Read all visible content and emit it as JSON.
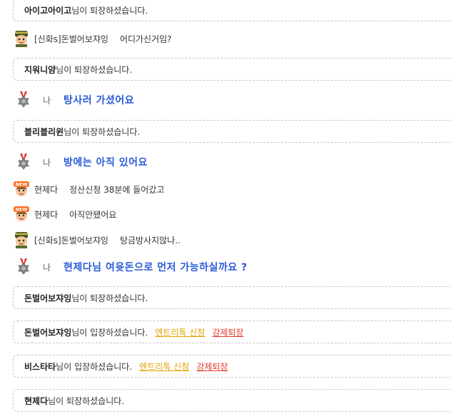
{
  "messages": [
    {
      "type": "system",
      "name": "아이고아이고",
      "suffix": "님이 퇴장하셨습니다."
    },
    {
      "type": "user",
      "nick": "[신화s]돈벌어보쟈잉",
      "text": "어디가신거임?",
      "avatar": "soldier-avatar-icon"
    },
    {
      "type": "system",
      "name": "지워니얌",
      "suffix": "님이 퇴장하셨습니다."
    },
    {
      "type": "mine",
      "me": "나",
      "text": "탕사러 가셨어요",
      "icon": "medal-icon"
    },
    {
      "type": "system",
      "name": "블리블리윈",
      "suffix": "님이 퇴장하셨습니다."
    },
    {
      "type": "mine",
      "me": "나",
      "text": "방에는 아직 있어요",
      "icon": "medal-icon"
    },
    {
      "type": "user",
      "nick": "현제다",
      "text": "정산신청 38분에 들어갔고",
      "avatar": "new-badge-avatar-icon"
    },
    {
      "type": "user",
      "nick": "현제다",
      "text": "아직안됐어요",
      "avatar": "new-badge-avatar-icon"
    },
    {
      "type": "user",
      "nick": "[신화s]돈벌어보쟈잉",
      "text": "탕금방사지않나..",
      "avatar": "soldier-avatar-icon"
    },
    {
      "type": "mine",
      "me": "나",
      "text": "현제다님 여윳돈으로 먼저 가능하실까요 ?",
      "icon": "medal-icon"
    },
    {
      "type": "system",
      "name": "돈벌어보쟈잉",
      "suffix": "님이 퇴장하셨습니다."
    },
    {
      "type": "system",
      "name": "돈벌어보쟈잉",
      "suffix": "님이 입장하셨습니다.",
      "link1": "엔트리톡 신청",
      "link2": "강제퇴장"
    },
    {
      "type": "system",
      "name": "비스타타",
      "suffix": "님이 입장하셨습니다.",
      "link1": "엔트리톡 신청",
      "link2": "강제퇴장"
    },
    {
      "type": "system",
      "name": "현제다",
      "suffix": "님이 퇴장하셨습니다."
    }
  ],
  "colors": {
    "accent": "#2a5bd8",
    "link_yellow": "#e0a400",
    "link_red": "#e03a2a",
    "border": "#c8c8c8"
  }
}
